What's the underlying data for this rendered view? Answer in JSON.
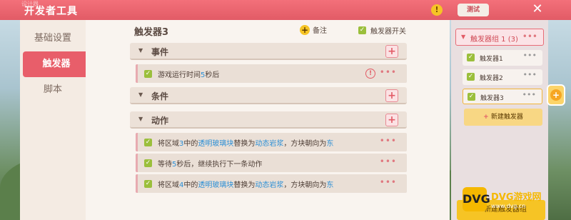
{
  "header": {
    "ghost_text": "设计器",
    "title": "开发者工具",
    "info_icon": "!",
    "test_label": "测试",
    "close_icon": "✕"
  },
  "leftnav": {
    "items": [
      {
        "label": "基础设置",
        "active": false
      },
      {
        "label": "触发器",
        "active": true
      },
      {
        "label": "脚本",
        "active": false
      }
    ]
  },
  "main": {
    "title": "触发器3",
    "note_label": "备注",
    "switch_label": "触发器开关",
    "sections": [
      {
        "label": "事件"
      },
      {
        "label": "条件"
      },
      {
        "label": "动作"
      }
    ],
    "event_rows": [
      {
        "parts": [
          "游戏运行时间",
          "5",
          "秒后"
        ]
      }
    ],
    "action_rows": [
      {
        "parts": [
          "将区域",
          "3",
          "中的",
          "透明玻璃块",
          "替换为",
          "动态岩浆",
          "，方块朝向为",
          "东"
        ]
      },
      {
        "parts": [
          "等待",
          "5",
          "秒后，继续执行下一条动作"
        ]
      },
      {
        "parts": [
          "将区域",
          "4",
          "中的",
          "透明玻璃块",
          "替换为",
          "动态岩浆",
          "，方块朝向为",
          "东"
        ]
      }
    ],
    "more_icon": "•••"
  },
  "right": {
    "group_label": "触发器组 1 (3)",
    "triggers": [
      {
        "label": "触发器1",
        "selected": false
      },
      {
        "label": "触发器2",
        "selected": false
      },
      {
        "label": "触发器3",
        "selected": true
      }
    ],
    "new_trigger_label": "新建触发器",
    "new_group_label": "新建触发器组"
  },
  "watermark": {
    "logo": "DVG",
    "text": "DVG游戏网",
    "sub": "www.dvg.cn"
  },
  "colors": {
    "accent": "#e25b66",
    "highlight": "#2b8fd6",
    "check": "#9bbf3c",
    "yellow": "#f6c425"
  }
}
